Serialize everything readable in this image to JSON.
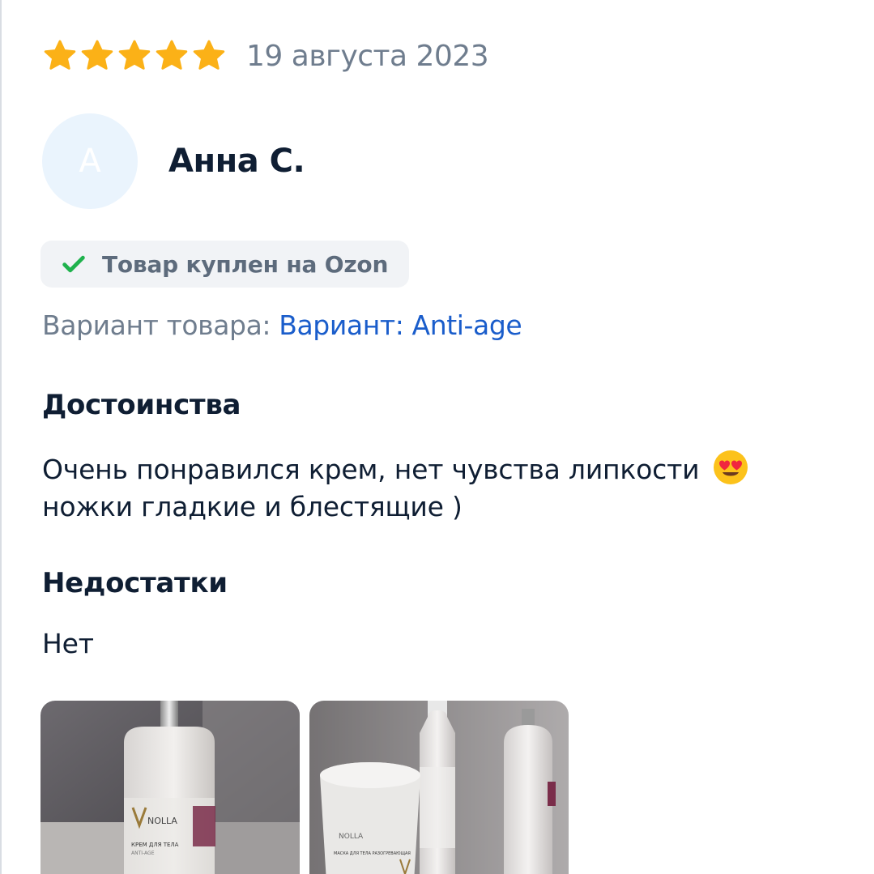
{
  "review": {
    "rating": 5,
    "rating_max": 5,
    "date": "19 августа 2023",
    "author": {
      "initial": "А",
      "name": "Анна С."
    },
    "verified_badge": "Товар куплен на Ozon",
    "variant_label": "Вариант товара:",
    "variant_value": "Вариант: Anti-age",
    "pros_title": "Достоинства",
    "pros_line1": "Очень понравился крем, нет чувства липкости",
    "pros_line2": "ножки гладкие и блестящие )",
    "cons_title": "Недостатки",
    "cons_text": "Нет",
    "photo1_brand": "NOLLA",
    "photo1_label": "КРЕМ ДЛЯ ТЕЛА",
    "photo1_sub": "ANTI-AGE",
    "photo2_brand": "NOLLA",
    "photo2_label": "МАСКА ДЛЯ ТЕЛА РАЗОГРЕВАЮЩАЯ"
  },
  "colors": {
    "star": "#fbb117",
    "check": "#1fb24d",
    "link": "#1a5dcb"
  },
  "icons": {
    "star": "star-icon",
    "check": "checkmark-icon",
    "emoji": "heart-eyes-emoji"
  }
}
